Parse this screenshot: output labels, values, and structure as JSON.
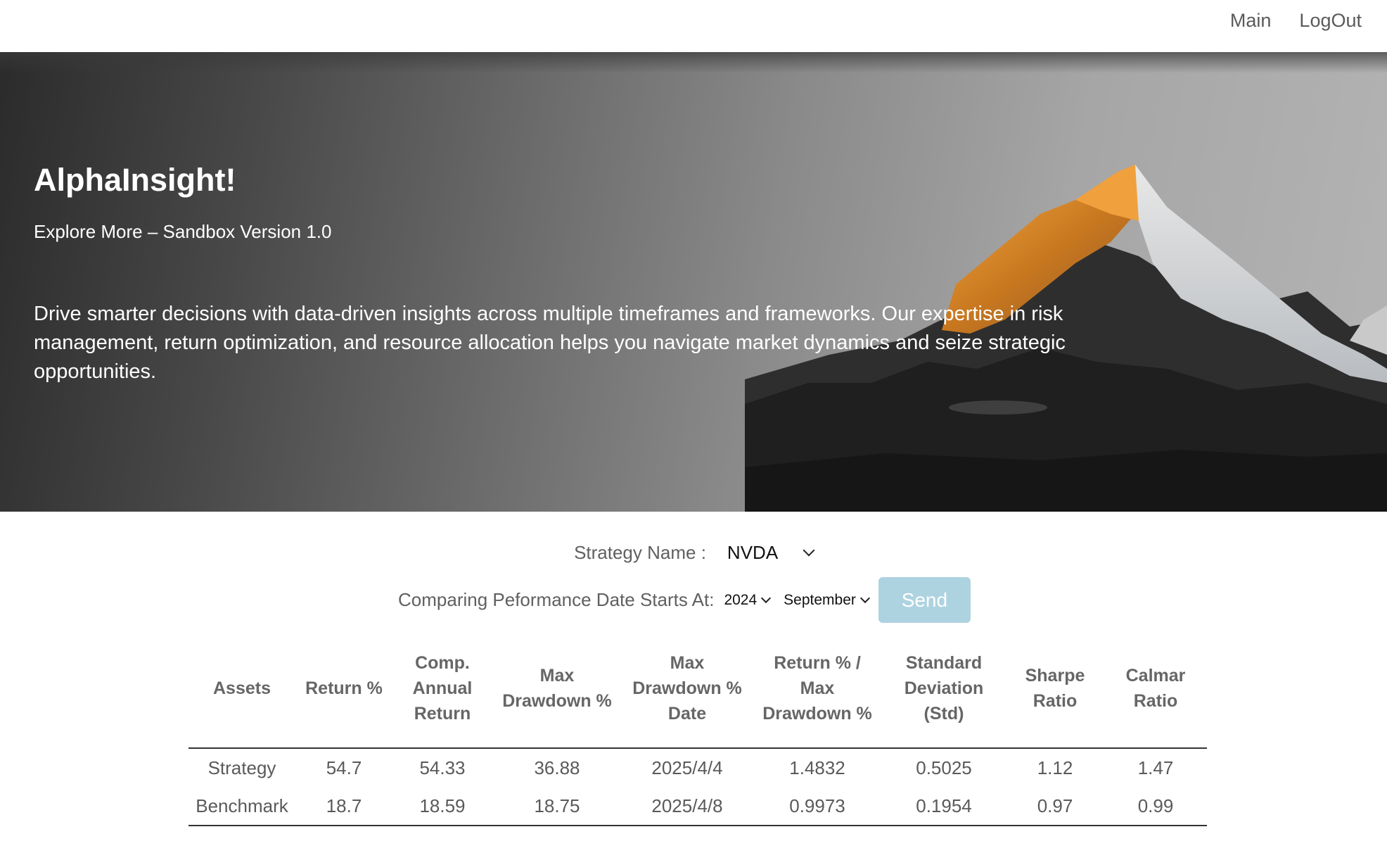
{
  "nav": {
    "main": "Main",
    "logout": "LogOut"
  },
  "hero": {
    "title": "AlphaInsight!",
    "subtitle": "Explore More – Sandbox Version 1.0",
    "description": "Drive smarter decisions with data-driven insights across multiple timeframes and frameworks. Our expertise in risk management, return optimization, and resource allocation helps you navigate market dynamics and seize strategic opportunities."
  },
  "controls": {
    "strategy_label": "Strategy Name :",
    "strategy_value": "NVDA",
    "date_label": "Comparing Peformance Date Starts At:",
    "year_value": "2024",
    "month_value": "September",
    "send_label": "Send"
  },
  "table": {
    "headers": [
      "Assets",
      "Return %",
      "Comp. Annual Return",
      "Max Drawdown %",
      "Max Drawdown % Date",
      "Return % / Max Drawdown %",
      "Standard Deviation (Std)",
      "Sharpe Ratio",
      "Calmar Ratio"
    ],
    "rows": [
      [
        "Strategy",
        "54.7",
        "54.33",
        "36.88",
        "2025/4/4",
        "1.4832",
        "0.5025",
        "1.12",
        "1.47"
      ],
      [
        "Benchmark",
        "18.7",
        "18.59",
        "18.75",
        "2025/4/8",
        "0.9973",
        "0.1954",
        "0.97",
        "0.99"
      ]
    ]
  },
  "colors": {
    "send_button": "#aed3e0",
    "hero_dark": "#2b2b2b",
    "hero_light": "#b4b4b4"
  }
}
